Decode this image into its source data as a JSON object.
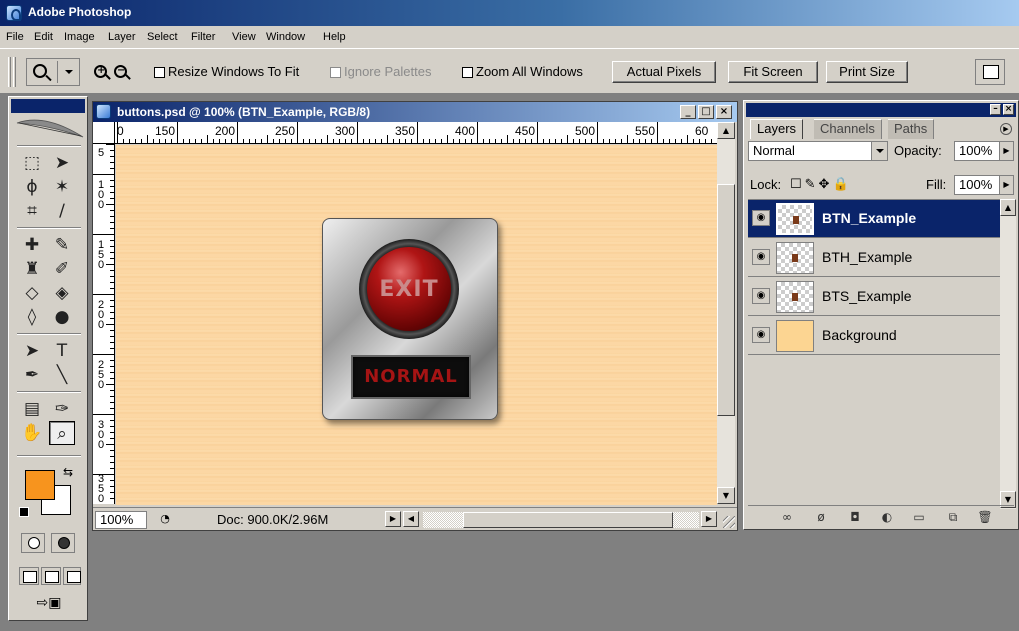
{
  "app": {
    "title": "Adobe Photoshop"
  },
  "menu": [
    "File",
    "Edit",
    "Image",
    "Layer",
    "Select",
    "Filter",
    "View",
    "Window",
    "Help"
  ],
  "options": {
    "resize_windows": "Resize Windows To Fit",
    "ignore_palettes": "Ignore Palettes",
    "zoom_all": "Zoom All Windows",
    "actual_pixels": "Actual Pixels",
    "fit_screen": "Fit Screen",
    "print_size": "Print Size"
  },
  "document": {
    "title": "buttons.psd @ 100% (BTN_Example, RGB/8)",
    "ruler_h": [
      "0",
      "150",
      "200",
      "250",
      "300",
      "350",
      "400",
      "450",
      "500",
      "550",
      "60"
    ],
    "ruler_v": [
      "5",
      "1 0 0",
      "1 5 0",
      "2 0 0",
      "2 5 0",
      "3 0 0",
      "3 5 0"
    ],
    "art_top_text": "EXIT",
    "art_bottom_text": "NORMAL",
    "zoom": "100%",
    "doc_info": "Doc: 900.0K/2.96M"
  },
  "layers_panel": {
    "tabs": [
      "Layers",
      "Channels",
      "Paths"
    ],
    "blend_mode": "Normal",
    "opacity_label": "Opacity:",
    "opacity": "100%",
    "lock_label": "Lock:",
    "fill_label": "Fill:",
    "fill": "100%",
    "layers": [
      {
        "name": "BTN_Example",
        "selected": true
      },
      {
        "name": "BTH_Example",
        "selected": false
      },
      {
        "name": "BTS_Example",
        "selected": false
      },
      {
        "name": "Background",
        "selected": false
      }
    ]
  },
  "colors": {
    "foreground": "#f7941e",
    "background": "#ffffff",
    "canvas": "#fcd592",
    "selection": "#0a246a"
  }
}
